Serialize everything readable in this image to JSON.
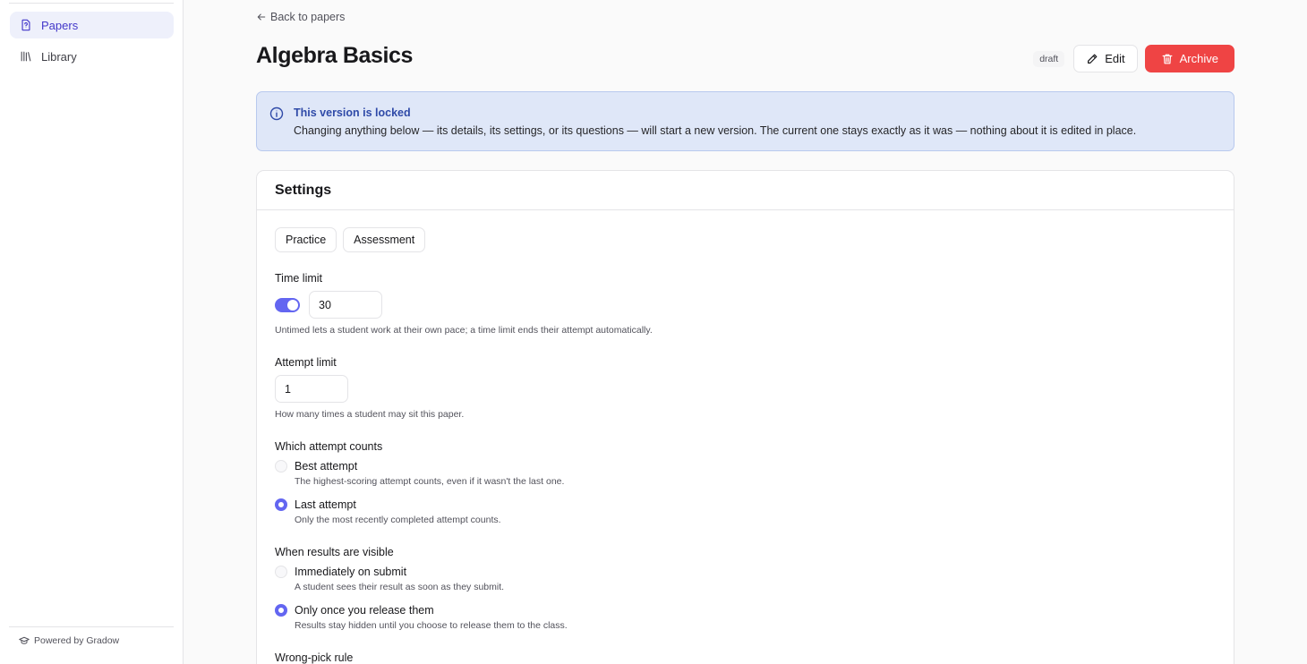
{
  "sidebar": {
    "items": [
      {
        "label": "Papers",
        "icon": "file-question-icon",
        "active": true
      },
      {
        "label": "Library",
        "icon": "library-icon",
        "active": false
      }
    ],
    "footer": "Powered by Gradow"
  },
  "header": {
    "back_label": "Back to papers",
    "title": "Algebra Basics",
    "status_badge": "draft",
    "edit_label": "Edit",
    "archive_label": "Archive"
  },
  "alert": {
    "title": "This version is locked",
    "body": "Changing anything below — its details, its settings, or its questions — will start a new version. The current one stays exactly as it was — nothing about it is edited in place."
  },
  "settings": {
    "title": "Settings",
    "presets": [
      "Practice",
      "Assessment"
    ],
    "time_limit": {
      "label": "Time limit",
      "enabled": true,
      "value": "30",
      "hint": "Untimed lets a student work at their own pace; a time limit ends their attempt automatically."
    },
    "attempt_limit": {
      "label": "Attempt limit",
      "value": "1",
      "hint": "How many times a student may sit this paper."
    },
    "attempt_counts": {
      "label": "Which attempt counts",
      "selected": "Last attempt",
      "options": [
        {
          "label": "Best attempt",
          "hint": "The highest-scoring attempt counts, even if it wasn't the last one."
        },
        {
          "label": "Last attempt",
          "hint": "Only the most recently completed attempt counts."
        }
      ]
    },
    "results_visible": {
      "label": "When results are visible",
      "selected": "Only once you release them",
      "options": [
        {
          "label": "Immediately on submit",
          "hint": "A student sees their result as soon as they submit."
        },
        {
          "label": "Only once you release them",
          "hint": "Results stay hidden until you choose to release them to the class."
        }
      ]
    },
    "wrong_pick": {
      "label": "Wrong-pick rule"
    }
  },
  "colors": {
    "accent": "#6366f1",
    "danger": "#ef4444",
    "alert_bg": "#dfe7f8",
    "alert_title": "#2f4aa8"
  }
}
